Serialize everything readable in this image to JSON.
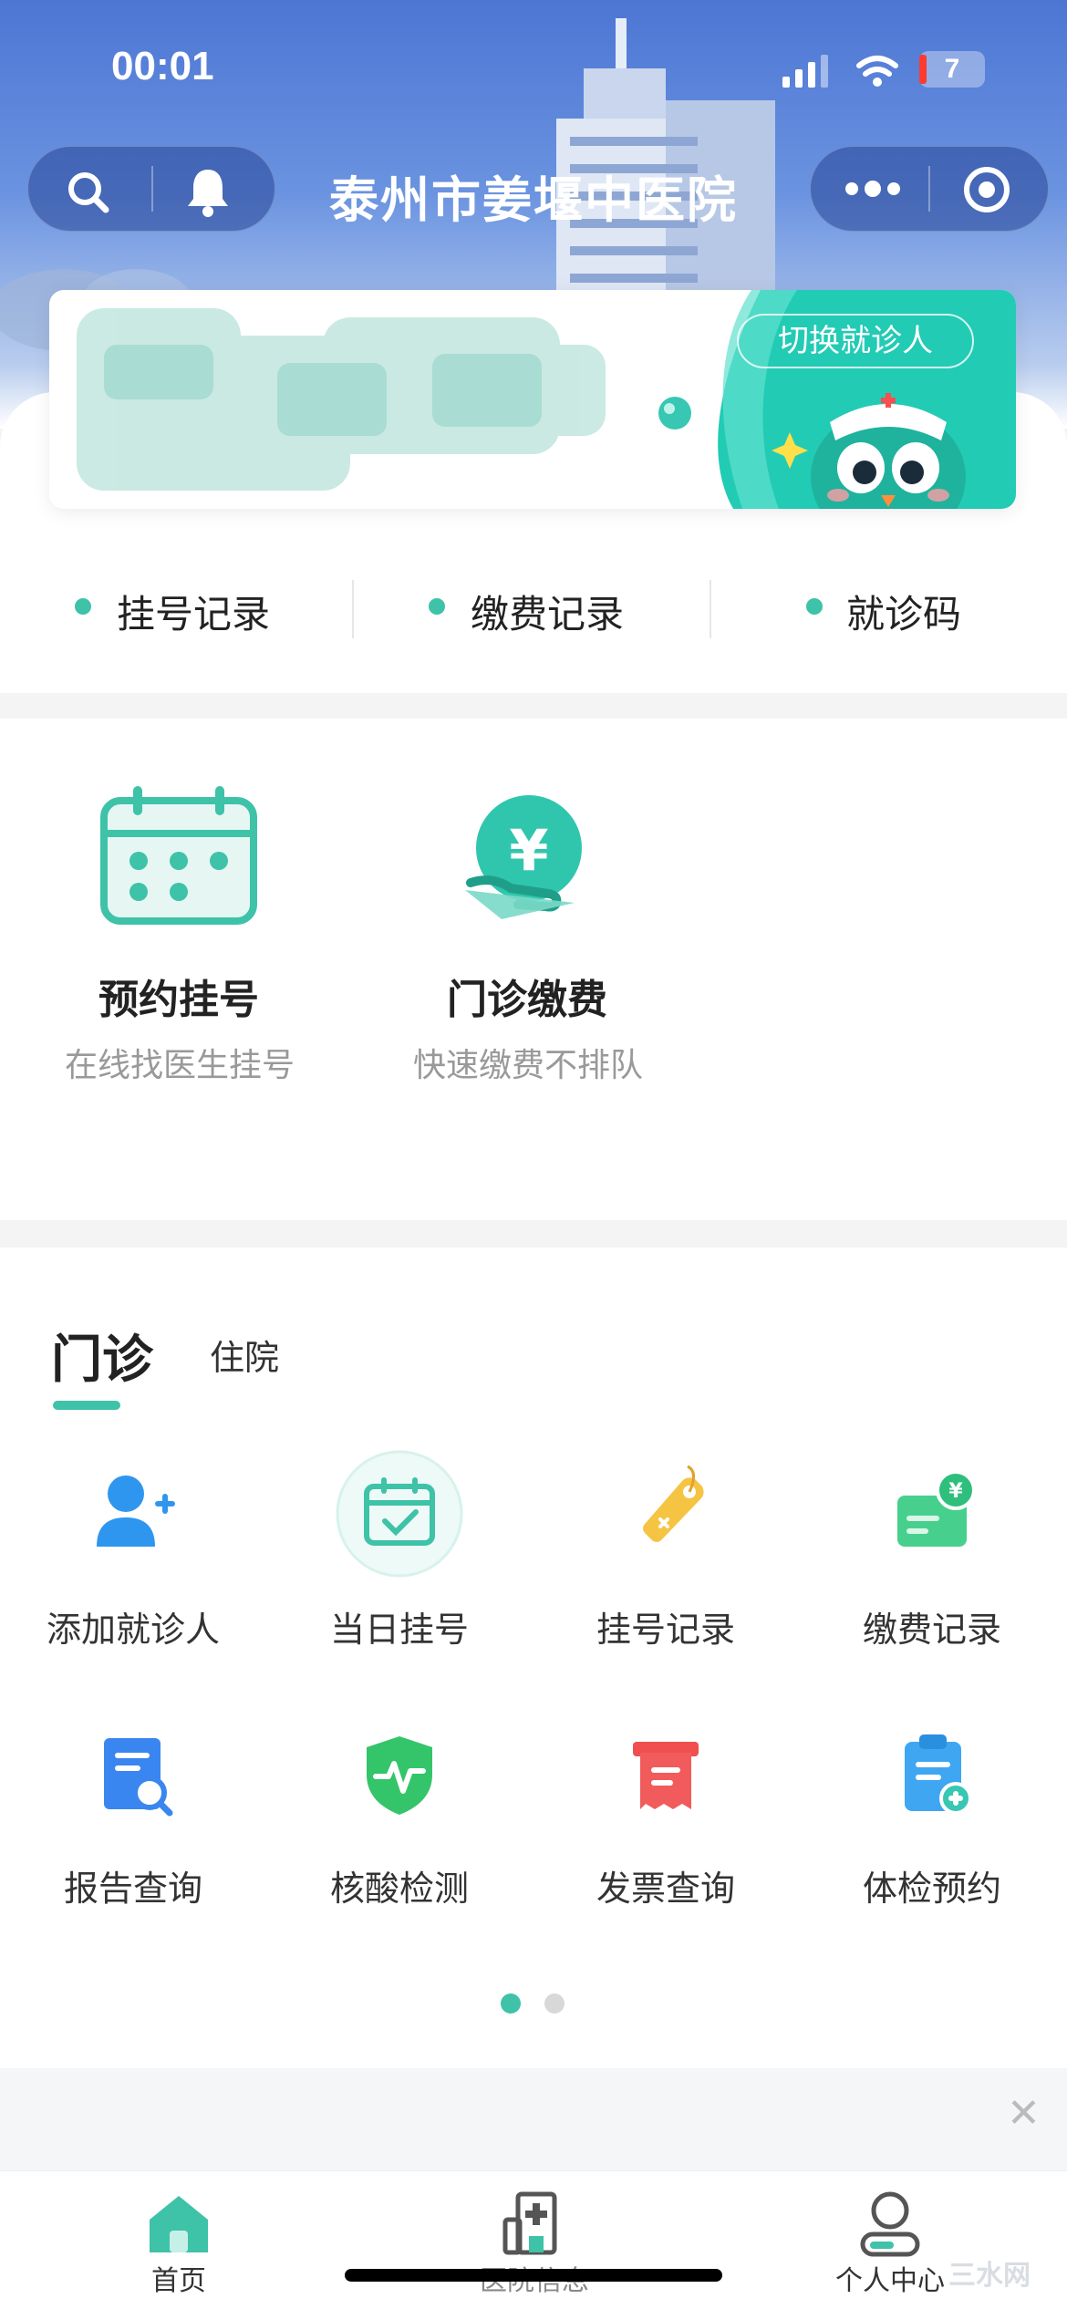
{
  "status_bar": {
    "time": "00:01",
    "battery": "7"
  },
  "header": {
    "title": "泰州市姜堰中医院"
  },
  "patient_card": {
    "switch_label": "切换就诊人"
  },
  "quick_links": [
    {
      "label": "挂号记录"
    },
    {
      "label": "缴费记录"
    },
    {
      "label": "就诊码"
    }
  ],
  "services": [
    {
      "title": "预约挂号",
      "subtitle": "在线找医生挂号"
    },
    {
      "title": "门诊缴费",
      "subtitle": "快速缴费不排队"
    }
  ],
  "tabs": [
    {
      "label": "门诊",
      "active": true
    },
    {
      "label": "住院",
      "active": false
    }
  ],
  "grid": [
    {
      "label": "添加就诊人",
      "icon": "add-user-icon"
    },
    {
      "label": "当日挂号",
      "icon": "calendar-check-icon"
    },
    {
      "label": "挂号记录",
      "icon": "tag-icon"
    },
    {
      "label": "缴费记录",
      "icon": "payment-card-icon"
    },
    {
      "label": "报告查询",
      "icon": "report-search-icon"
    },
    {
      "label": "核酸检测",
      "icon": "shield-pulse-icon"
    },
    {
      "label": "发票查询",
      "icon": "receipt-icon"
    },
    {
      "label": "体检预约",
      "icon": "clipboard-add-icon"
    }
  ],
  "pager": {
    "pages": 2,
    "current": 1
  },
  "tabbar": [
    {
      "label": "首页",
      "active": true
    },
    {
      "label": "医院信息",
      "active": false
    },
    {
      "label": "个人中心",
      "active": false
    }
  ],
  "colors": {
    "accent": "#3ec2a8",
    "header_blue": "#4d76d4"
  },
  "watermark": "三水网"
}
